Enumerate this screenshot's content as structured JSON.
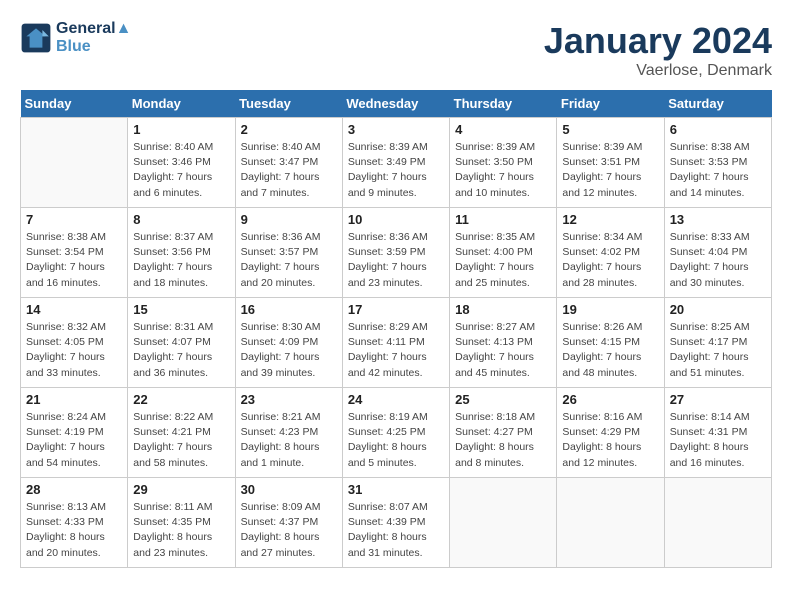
{
  "header": {
    "logo_line1": "General",
    "logo_line2": "Blue",
    "month": "January 2024",
    "location": "Vaerlose, Denmark"
  },
  "days_of_week": [
    "Sunday",
    "Monday",
    "Tuesday",
    "Wednesday",
    "Thursday",
    "Friday",
    "Saturday"
  ],
  "weeks": [
    [
      {
        "day": "",
        "content": ""
      },
      {
        "day": "1",
        "content": "Sunrise: 8:40 AM\nSunset: 3:46 PM\nDaylight: 7 hours\nand 6 minutes."
      },
      {
        "day": "2",
        "content": "Sunrise: 8:40 AM\nSunset: 3:47 PM\nDaylight: 7 hours\nand 7 minutes."
      },
      {
        "day": "3",
        "content": "Sunrise: 8:39 AM\nSunset: 3:49 PM\nDaylight: 7 hours\nand 9 minutes."
      },
      {
        "day": "4",
        "content": "Sunrise: 8:39 AM\nSunset: 3:50 PM\nDaylight: 7 hours\nand 10 minutes."
      },
      {
        "day": "5",
        "content": "Sunrise: 8:39 AM\nSunset: 3:51 PM\nDaylight: 7 hours\nand 12 minutes."
      },
      {
        "day": "6",
        "content": "Sunrise: 8:38 AM\nSunset: 3:53 PM\nDaylight: 7 hours\nand 14 minutes."
      }
    ],
    [
      {
        "day": "7",
        "content": "Sunrise: 8:38 AM\nSunset: 3:54 PM\nDaylight: 7 hours\nand 16 minutes."
      },
      {
        "day": "8",
        "content": "Sunrise: 8:37 AM\nSunset: 3:56 PM\nDaylight: 7 hours\nand 18 minutes."
      },
      {
        "day": "9",
        "content": "Sunrise: 8:36 AM\nSunset: 3:57 PM\nDaylight: 7 hours\nand 20 minutes."
      },
      {
        "day": "10",
        "content": "Sunrise: 8:36 AM\nSunset: 3:59 PM\nDaylight: 7 hours\nand 23 minutes."
      },
      {
        "day": "11",
        "content": "Sunrise: 8:35 AM\nSunset: 4:00 PM\nDaylight: 7 hours\nand 25 minutes."
      },
      {
        "day": "12",
        "content": "Sunrise: 8:34 AM\nSunset: 4:02 PM\nDaylight: 7 hours\nand 28 minutes."
      },
      {
        "day": "13",
        "content": "Sunrise: 8:33 AM\nSunset: 4:04 PM\nDaylight: 7 hours\nand 30 minutes."
      }
    ],
    [
      {
        "day": "14",
        "content": "Sunrise: 8:32 AM\nSunset: 4:05 PM\nDaylight: 7 hours\nand 33 minutes."
      },
      {
        "day": "15",
        "content": "Sunrise: 8:31 AM\nSunset: 4:07 PM\nDaylight: 7 hours\nand 36 minutes."
      },
      {
        "day": "16",
        "content": "Sunrise: 8:30 AM\nSunset: 4:09 PM\nDaylight: 7 hours\nand 39 minutes."
      },
      {
        "day": "17",
        "content": "Sunrise: 8:29 AM\nSunset: 4:11 PM\nDaylight: 7 hours\nand 42 minutes."
      },
      {
        "day": "18",
        "content": "Sunrise: 8:27 AM\nSunset: 4:13 PM\nDaylight: 7 hours\nand 45 minutes."
      },
      {
        "day": "19",
        "content": "Sunrise: 8:26 AM\nSunset: 4:15 PM\nDaylight: 7 hours\nand 48 minutes."
      },
      {
        "day": "20",
        "content": "Sunrise: 8:25 AM\nSunset: 4:17 PM\nDaylight: 7 hours\nand 51 minutes."
      }
    ],
    [
      {
        "day": "21",
        "content": "Sunrise: 8:24 AM\nSunset: 4:19 PM\nDaylight: 7 hours\nand 54 minutes."
      },
      {
        "day": "22",
        "content": "Sunrise: 8:22 AM\nSunset: 4:21 PM\nDaylight: 7 hours\nand 58 minutes."
      },
      {
        "day": "23",
        "content": "Sunrise: 8:21 AM\nSunset: 4:23 PM\nDaylight: 8 hours\nand 1 minute."
      },
      {
        "day": "24",
        "content": "Sunrise: 8:19 AM\nSunset: 4:25 PM\nDaylight: 8 hours\nand 5 minutes."
      },
      {
        "day": "25",
        "content": "Sunrise: 8:18 AM\nSunset: 4:27 PM\nDaylight: 8 hours\nand 8 minutes."
      },
      {
        "day": "26",
        "content": "Sunrise: 8:16 AM\nSunset: 4:29 PM\nDaylight: 8 hours\nand 12 minutes."
      },
      {
        "day": "27",
        "content": "Sunrise: 8:14 AM\nSunset: 4:31 PM\nDaylight: 8 hours\nand 16 minutes."
      }
    ],
    [
      {
        "day": "28",
        "content": "Sunrise: 8:13 AM\nSunset: 4:33 PM\nDaylight: 8 hours\nand 20 minutes."
      },
      {
        "day": "29",
        "content": "Sunrise: 8:11 AM\nSunset: 4:35 PM\nDaylight: 8 hours\nand 23 minutes."
      },
      {
        "day": "30",
        "content": "Sunrise: 8:09 AM\nSunset: 4:37 PM\nDaylight: 8 hours\nand 27 minutes."
      },
      {
        "day": "31",
        "content": "Sunrise: 8:07 AM\nSunset: 4:39 PM\nDaylight: 8 hours\nand 31 minutes."
      },
      {
        "day": "",
        "content": ""
      },
      {
        "day": "",
        "content": ""
      },
      {
        "day": "",
        "content": ""
      }
    ]
  ]
}
